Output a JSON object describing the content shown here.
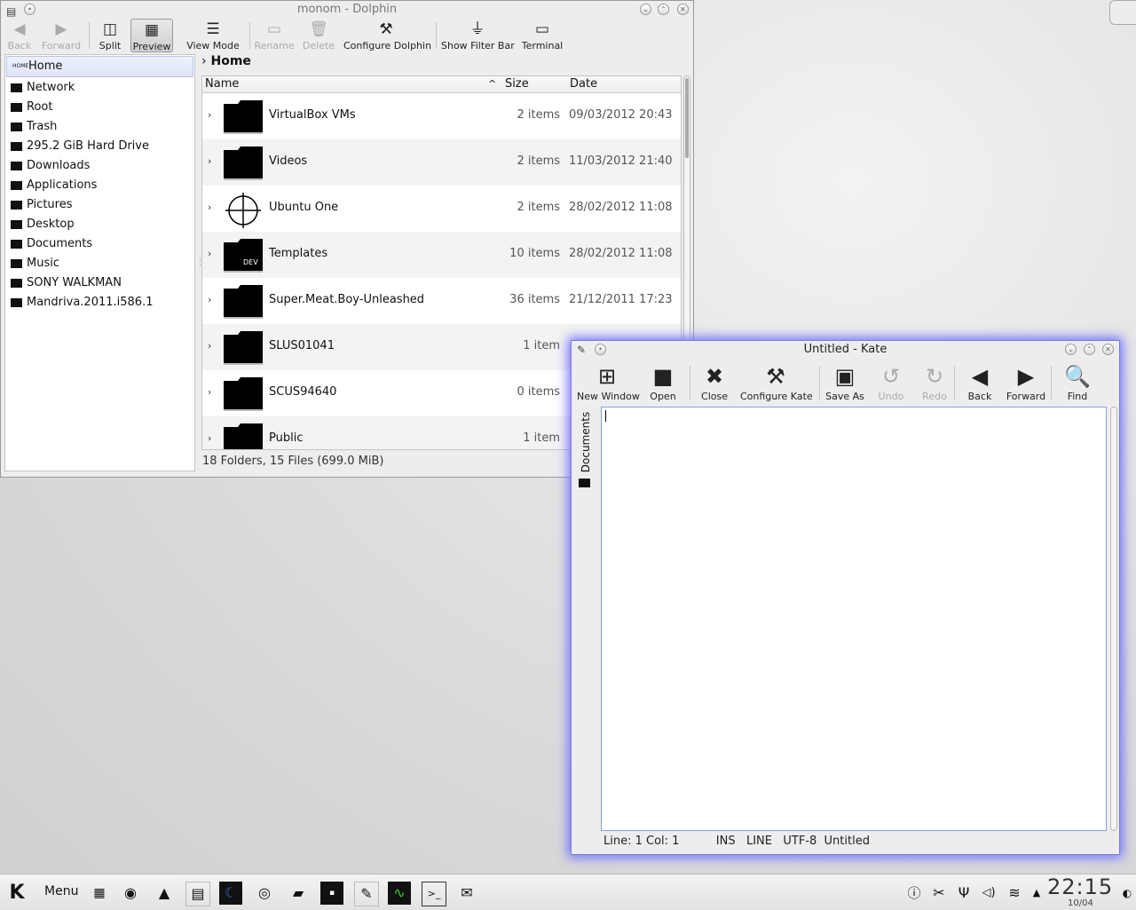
{
  "dolphin": {
    "title": "monom - Dolphin",
    "toolbar": [
      {
        "icon": "back-arrow-icon",
        "glyph": "◀",
        "label": "Back",
        "disabled": true
      },
      {
        "icon": "forward-arrow-icon",
        "glyph": "▶",
        "label": "Forward",
        "disabled": true
      },
      {
        "icon": "split-icon",
        "glyph": "◫",
        "label": "Split"
      },
      {
        "icon": "preview-icon",
        "glyph": "▦",
        "label": "Preview",
        "active": true
      },
      {
        "icon": "view-mode-icon",
        "glyph": "☰",
        "label": "View Mode"
      },
      {
        "icon": "rename-icon",
        "glyph": "▭",
        "label": "Rename",
        "disabled": true
      },
      {
        "icon": "delete-icon",
        "glyph": "🗑",
        "label": "Delete",
        "disabled": true
      },
      {
        "icon": "configure-icon",
        "glyph": "⚒",
        "label": "Configure Dolphin"
      },
      {
        "icon": "filter-icon",
        "glyph": "⏚",
        "label": "Show Filter Bar"
      },
      {
        "icon": "terminal-icon",
        "glyph": "▭",
        "label": "Terminal"
      }
    ],
    "places": [
      "Home",
      "Network",
      "Root",
      "Trash",
      "295.2 GiB Hard Drive",
      "Downloads",
      "Applications",
      "Pictures",
      "Desktop",
      "Documents",
      "Music",
      "SONY WALKMAN",
      "Mandriva.2011.i586.1"
    ],
    "breadcrumb": "Home",
    "columns": {
      "name": "Name",
      "size": "Size",
      "date": "Date"
    },
    "files": [
      {
        "name": "VirtualBox VMs",
        "size": "2 items",
        "date": "09/03/2012 20:43"
      },
      {
        "name": "Videos",
        "size": "2 items",
        "date": "11/03/2012 21:40"
      },
      {
        "name": "Ubuntu One",
        "size": "2 items",
        "date": "28/02/2012 11:08"
      },
      {
        "name": "Templates",
        "size": "10 items",
        "date": "28/02/2012 11:08",
        "badge": "DEV"
      },
      {
        "name": "Super.Meat.Boy-Unleashed",
        "size": "36 items",
        "date": "21/12/2011 17:23"
      },
      {
        "name": "SLUS01041",
        "size": "1 item",
        "date": ""
      },
      {
        "name": "SCUS94640",
        "size": "0 items",
        "date": ""
      },
      {
        "name": "Public",
        "size": "1 item",
        "date": ""
      }
    ],
    "status": "18 Folders, 15 Files (699.0 MiB)"
  },
  "kate": {
    "title": "Untitled - Kate",
    "toolbar": [
      {
        "icon": "new-window-icon",
        "glyph": "⊞",
        "label": "New Window"
      },
      {
        "icon": "open-folder-icon",
        "glyph": "■",
        "label": "Open"
      },
      {
        "icon": "close-icon",
        "glyph": "✖",
        "label": "Close"
      },
      {
        "icon": "configure-icon",
        "glyph": "⚒",
        "label": "Configure Kate"
      },
      {
        "icon": "save-as-icon",
        "glyph": "▣",
        "label": "Save As"
      },
      {
        "icon": "undo-icon",
        "glyph": "↺",
        "label": "Undo",
        "disabled": true
      },
      {
        "icon": "redo-icon",
        "glyph": "↻",
        "label": "Redo",
        "disabled": true
      },
      {
        "icon": "back-arrow-icon",
        "glyph": "◀",
        "label": "Back"
      },
      {
        "icon": "forward-arrow-icon",
        "glyph": "▶",
        "label": "Forward"
      },
      {
        "icon": "find-icon",
        "glyph": "🔍",
        "label": "Find"
      }
    ],
    "side_tab": "Documents",
    "status": "Line: 1 Col: 1          INS   LINE   UTF-8  Untitled"
  },
  "taskbar": {
    "menu_label": "Menu",
    "clock": "22:15",
    "date": "10/04"
  }
}
